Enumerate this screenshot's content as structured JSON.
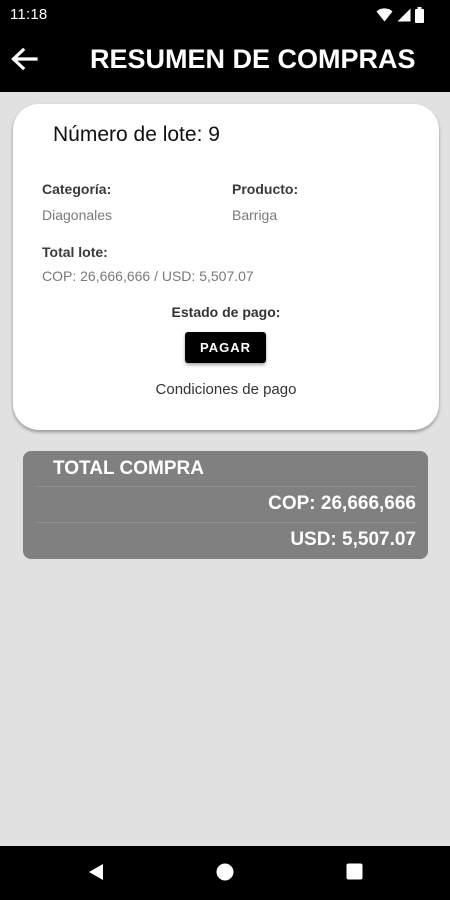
{
  "status_bar": {
    "time": "11:18",
    "icons": [
      "wifi-icon",
      "signal-icon",
      "battery-icon"
    ]
  },
  "app_bar": {
    "title": "RESUMEN DE COMPRAS",
    "back_icon": "arrow-left-icon"
  },
  "lot": {
    "title": "Número de lote: 9",
    "category_label": "Categoría:",
    "category_value": "Diagonales",
    "product_label": "Producto:",
    "product_value": "Barriga",
    "total_label": "Total lote:",
    "total_value": "COP: 26,666,666 / USD: 5,507.07",
    "payment_status_label": "Estado de pago:",
    "pay_button_label": "PAGAR",
    "conditions_label": "Condiciones de pago"
  },
  "total": {
    "title": "TOTAL COMPRA",
    "cop": "COP: 26,666,666",
    "usd": "USD: 5,507.07"
  },
  "nav_bar": {
    "icons": [
      "back-triangle-icon",
      "home-circle-icon",
      "recents-square-icon"
    ]
  },
  "colors": {
    "bar_background": "#000000",
    "screen_background": "#e1e1e1",
    "card_background": "#ffffff",
    "total_box_background": "#808080"
  }
}
